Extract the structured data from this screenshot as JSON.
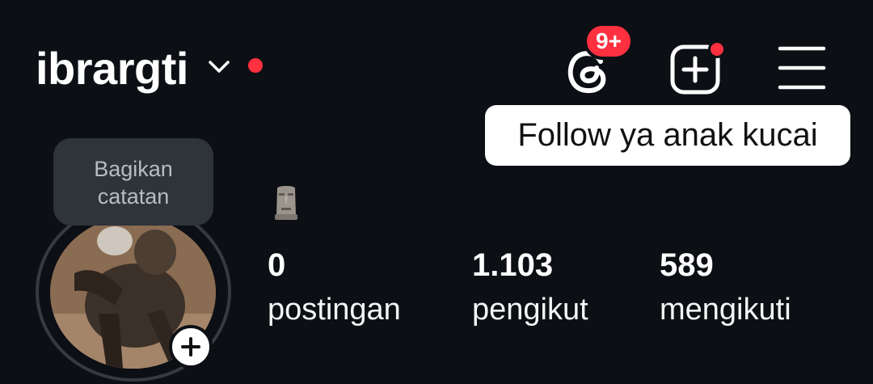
{
  "header": {
    "username": "ibrargti",
    "threads_badge": "9+",
    "tooltip": "Follow ya anak kucai"
  },
  "profile": {
    "note_bubble": {
      "line1": "Bagikan",
      "line2": "catatan"
    },
    "bio_emoji": "moai",
    "stats": [
      {
        "value": "0",
        "label": "postingan"
      },
      {
        "value": "1.103",
        "label": "pengikut"
      },
      {
        "value": "589",
        "label": "mengikuti"
      }
    ]
  },
  "icons": {
    "switch_account": "chevron-down-icon",
    "threads": "threads-icon",
    "create": "add-post-icon",
    "menu": "hamburger-menu-icon",
    "add_story": "plus-icon"
  },
  "colors": {
    "background": "#0c0f14",
    "notification": "#ff3040",
    "note_bubble": "#2f333a"
  }
}
